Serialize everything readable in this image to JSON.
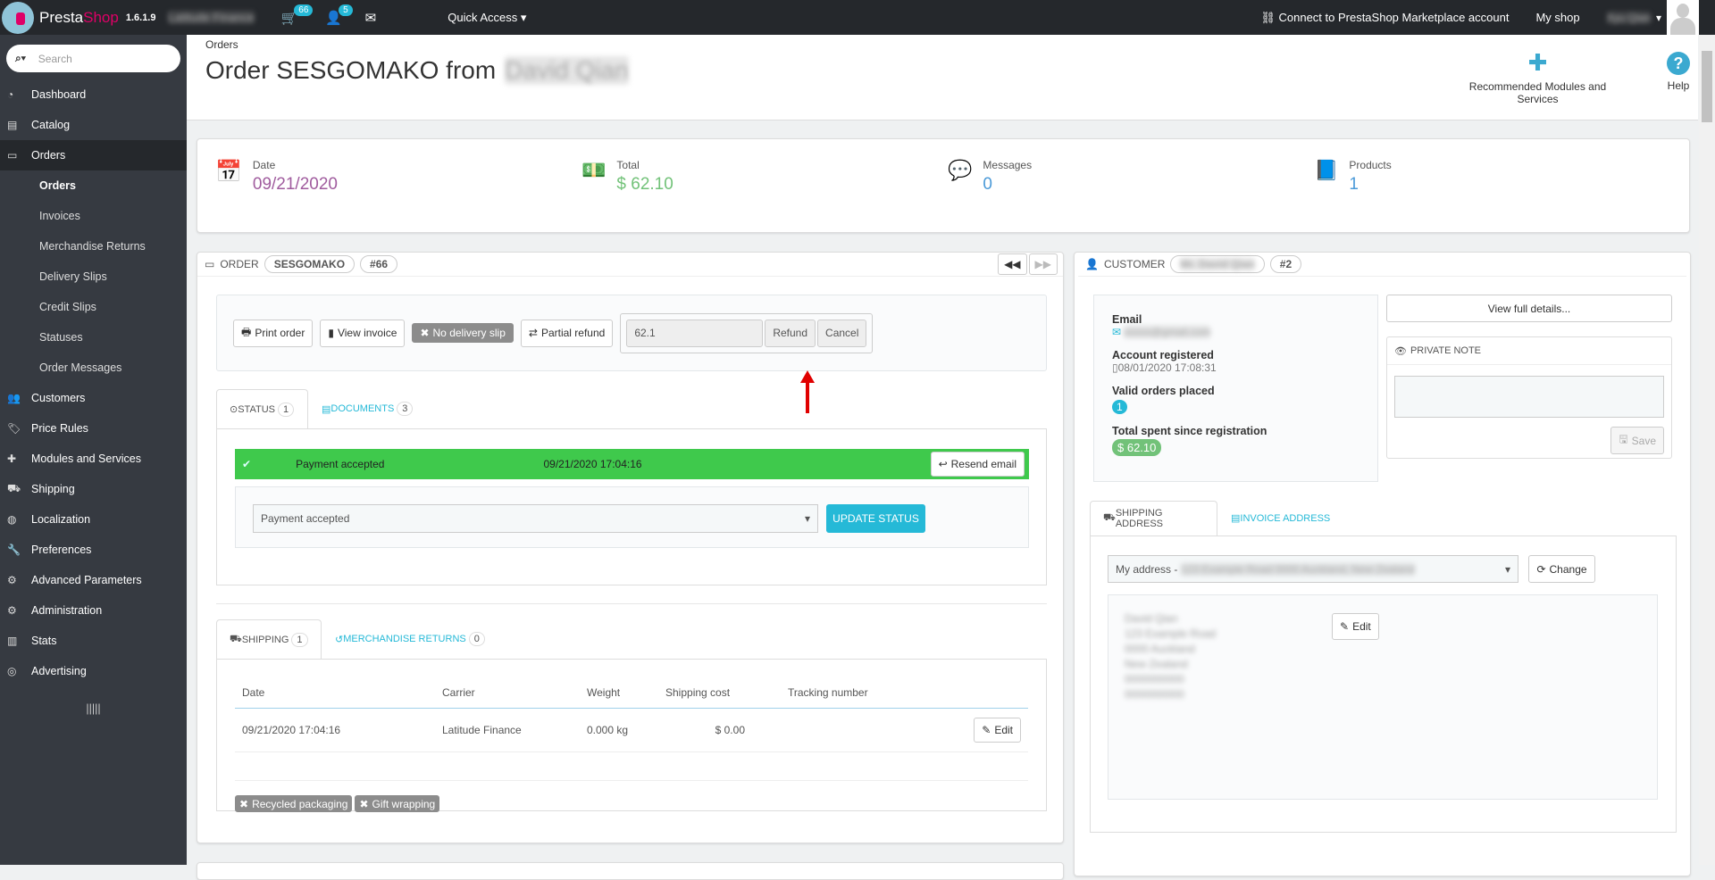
{
  "topbar": {
    "brand_a": "Presta",
    "brand_b": "Shop",
    "version": "1.6.1.9",
    "shop_name": "Latitude Finance",
    "cart_badge": "66",
    "customers_badge": "5",
    "quick_access": "Quick Access",
    "marketplace": "Connect to PrestaShop Marketplace account",
    "my_shop": "My shop",
    "employee": "Xyu Qian"
  },
  "sidebar": {
    "search_placeholder": "Search",
    "items": [
      {
        "label": "Dashboard"
      },
      {
        "label": "Catalog"
      },
      {
        "label": "Orders"
      },
      {
        "label": "Orders"
      },
      {
        "label": "Invoices"
      },
      {
        "label": "Merchandise Returns"
      },
      {
        "label": "Delivery Slips"
      },
      {
        "label": "Credit Slips"
      },
      {
        "label": "Statuses"
      },
      {
        "label": "Order Messages"
      },
      {
        "label": "Customers"
      },
      {
        "label": "Price Rules"
      },
      {
        "label": "Modules and Services"
      },
      {
        "label": "Shipping"
      },
      {
        "label": "Localization"
      },
      {
        "label": "Preferences"
      },
      {
        "label": "Advanced Parameters"
      },
      {
        "label": "Administration"
      },
      {
        "label": "Stats"
      },
      {
        "label": "Advertising"
      }
    ]
  },
  "header": {
    "breadcrumb": "Orders",
    "title": "Order SESGOMAKO from",
    "customer_name": "David Qian",
    "modules": "Recommended Modules and Services",
    "help": "Help"
  },
  "kpis": [
    {
      "label": "Date",
      "value": "09/21/2020",
      "color": "#a05c9e"
    },
    {
      "label": "Total",
      "value": "$ 62.10",
      "color": "#72c279"
    },
    {
      "label": "Messages",
      "value": "0",
      "color": "#4b9ad8"
    },
    {
      "label": "Products",
      "value": "1",
      "color": "#4b9ad8"
    }
  ],
  "order": {
    "heading": "ORDER",
    "reference": "SESGOMAKO",
    "id": "#66",
    "buttons": {
      "print": "Print order",
      "view_invoice": "View invoice",
      "no_delivery": "No delivery slip",
      "partial_refund": "Partial refund",
      "refund_amount": "62.1",
      "refund": "Refund",
      "cancel": "Cancel"
    },
    "status_tabs": {
      "status": "STATUS",
      "status_count": "1",
      "documents": "DOCUMENTS",
      "documents_count": "3"
    },
    "status_row": {
      "status": "Payment accepted",
      "date": "09/21/2020 17:04:16",
      "resend": "Resend email",
      "color": "#3fc94c"
    },
    "status_select": "Payment accepted",
    "update_status": "UPDATE STATUS",
    "shipping_tabs": {
      "shipping": "SHIPPING",
      "shipping_count": "1",
      "returns": "MERCHANDISE RETURNS",
      "returns_count": "0"
    },
    "shipping_table": {
      "headers": [
        "Date",
        "Carrier",
        "Weight",
        "Shipping cost",
        "Tracking number"
      ],
      "rows": [
        {
          "date": "09/21/2020 17:04:16",
          "carrier": "Latitude Finance",
          "weight": "0.000 kg",
          "cost": "$ 0.00",
          "tracking": "",
          "edit": "Edit"
        }
      ]
    },
    "tags": [
      "Recycled packaging",
      "Gift wrapping"
    ]
  },
  "customer": {
    "heading": "CUSTOMER",
    "name": "Mr. David Qian",
    "id": "#2",
    "email_label": "Email",
    "email": "xxxxx@gmail.com",
    "registered_label": "Account registered",
    "registered": "08/01/2020 17:08:31",
    "orders_label": "Valid orders placed",
    "orders": "1",
    "spent_label": "Total spent since registration",
    "spent": "$ 62.10",
    "view_details": "View full details...",
    "private_note": "PRIVATE NOTE",
    "save": "Save",
    "address_tabs": {
      "shipping": "SHIPPING ADDRESS",
      "invoice": "INVOICE ADDRESS"
    },
    "address_select": "My address - ",
    "address_select_blur": "123 Example Road 0000 Auckland, New Zealand",
    "change": "Change",
    "edit": "Edit",
    "address_lines": [
      "David Qian",
      "123 Example Road",
      "0000 Auckland",
      "New Zealand",
      "0000000000",
      "0000000000"
    ]
  }
}
